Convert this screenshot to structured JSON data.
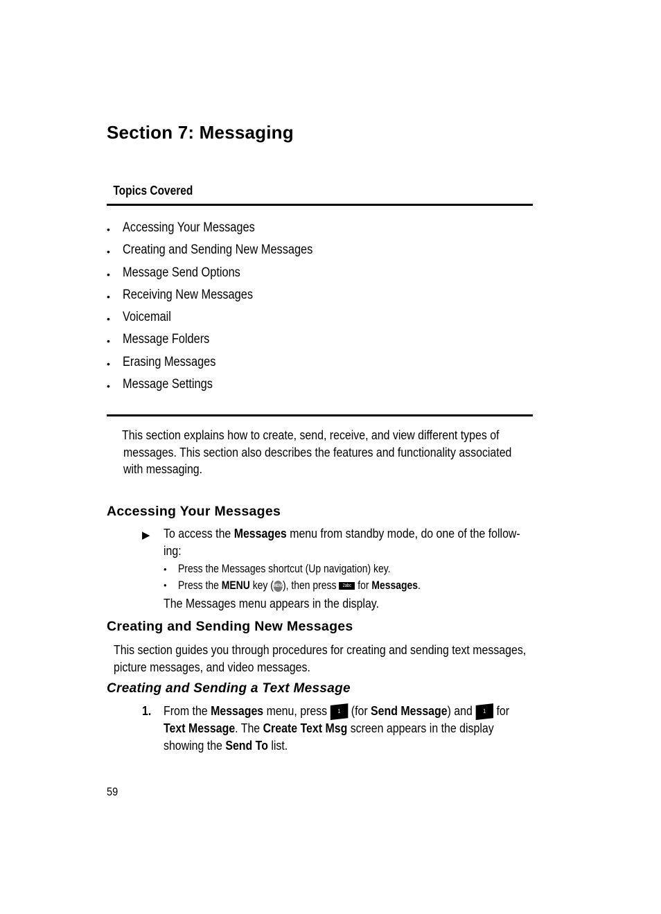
{
  "section_title": "Section 7:  Messaging",
  "topics_heading": "Topics Covered",
  "topics": [
    "Accessing Your Messages",
    "Creating and Sending New Messages",
    "Message Send Options",
    "Receiving New Messages",
    "Voicemail",
    "Message Folders",
    "Erasing Messages",
    "Message Settings"
  ],
  "bullet": "•",
  "intro": {
    "line1": "This section explains how to create, send, receive, and view different types of",
    "line2": "messages. This section also describes the features and functionality associated",
    "line3": "with messaging."
  },
  "accessing": {
    "heading": "Accessing Your Messages",
    "arrow": "▶",
    "line1_a": "To access the ",
    "line1_b": "Messages",
    "line1_c": " menu from standby mode, do one of the follow-",
    "line2": "ing:",
    "opt1": "Press the Messages shortcut (Up navigation) key.",
    "opt2_a": "Press the ",
    "opt2_b": "MENU",
    "opt2_c": " key (",
    "opt2_icon": "MENU OK",
    "opt2_d": "), then press ",
    "opt2_key": "2abc",
    "opt2_e": " for ",
    "opt2_f": "Messages",
    "opt2_g": ".",
    "result": "The Messages menu appears in the display."
  },
  "creating": {
    "heading": "Creating and Sending New Messages",
    "line1": "This section guides you through procedures for creating and sending text messages,",
    "line2": "picture messages, and video messages."
  },
  "text_message": {
    "heading": "Creating and Sending a Text Message",
    "step_number": "1.",
    "s1": "From the ",
    "s2": "Messages",
    "s3": " menu, press ",
    "key1": "1",
    "s4": " (for ",
    "s5": "Send Message",
    "s6": ") and ",
    "key2": "1",
    "s7": " for",
    "l2a": "Text Message",
    "l2b": ". The ",
    "l2c": "Create Text Msg",
    "l2d": " screen appears in the display",
    "l3a": "showing the ",
    "l3b": "Send To",
    "l3c": " list."
  },
  "page_number": "59"
}
